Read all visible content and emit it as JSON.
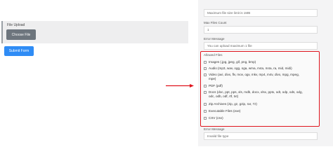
{
  "form": {
    "upload_label": "File Upload",
    "choose_label": "Choose File",
    "submit_label": "Submit Form"
  },
  "settings": {
    "max_size_value": "Maximum file size limit is 1MB",
    "max_files_label": "Max Files Count",
    "max_files_value": "1",
    "error_msg_label": "Error Message",
    "error_msg_value": "You can upload maximum 1 file",
    "allowed_files_label": "Allowed Files",
    "allowed_files": [
      "Images (.jpg, jpeg, gif, png, bmp)",
      "Audio (mp3, wav, ogg, oga, wma, m4a, m4a, ra, mid, midi)",
      "Video (avi, divx, flv, mov, ogv, mkv, mp4, m4v, divx, mpg, mpeg,",
      "mpe)",
      "PDF (pdf)",
      "Docs (doc, ppt, pps, xls, mdb, docx, xlsx, pptx, odt, odp, ods, odg,",
      "odc, odb, odf, rtf, txt)",
      "Zip Archives (zip, gz, gzip, rar, 7z)",
      "Executable Files (exe)",
      "CSV (csv)"
    ],
    "error_msg2_label": "Error Message",
    "error_msg2_value": "Invalid file type"
  },
  "colors": {
    "highlight": "#e0141d",
    "submit": "#2f8cf5",
    "choose": "#6d757d"
  }
}
